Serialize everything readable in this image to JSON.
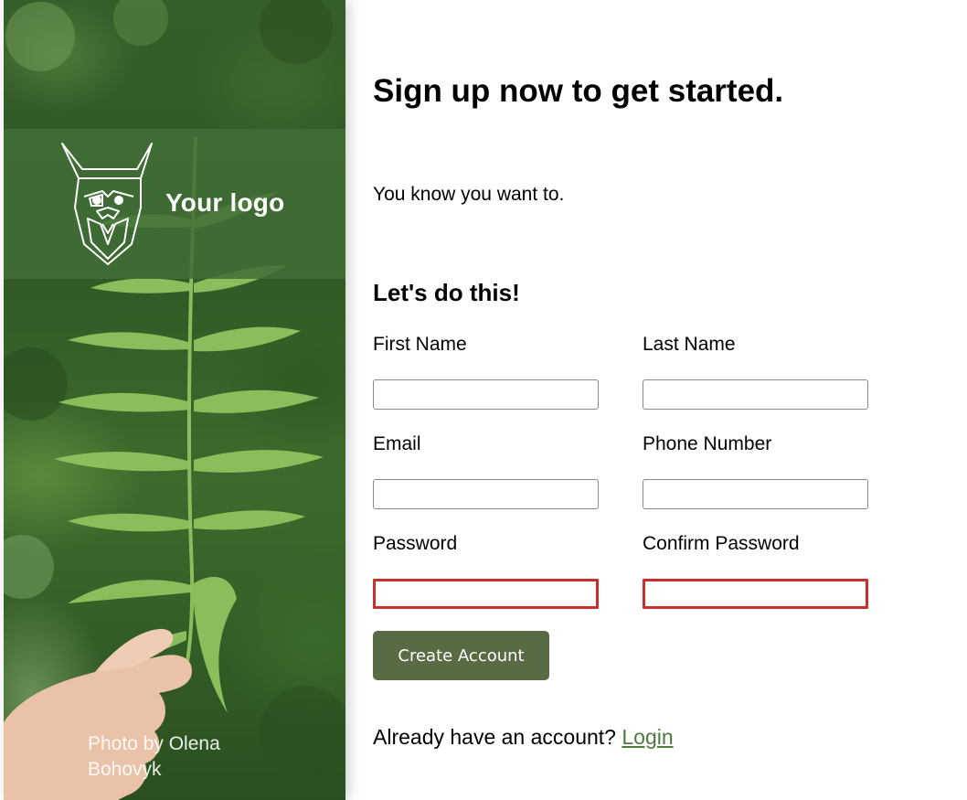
{
  "brand": {
    "logo_text": "Your logo",
    "photo_credit": "Photo by Olena Bohovyk"
  },
  "signup": {
    "headline": "Sign up now to get started.",
    "tagline": "You know you want to.",
    "subheading": "Let's do this!",
    "fields": {
      "first_name": {
        "label": "First Name",
        "value": ""
      },
      "last_name": {
        "label": "Last Name",
        "value": ""
      },
      "email": {
        "label": "Email",
        "value": ""
      },
      "phone": {
        "label": "Phone Number",
        "value": ""
      },
      "password": {
        "label": "Password",
        "value": "",
        "state": "invalid"
      },
      "confirm_password": {
        "label": "Confirm Password",
        "value": "",
        "state": "invalid"
      }
    },
    "submit_label": "Create Account",
    "login_prompt": "Already have an account?",
    "login_link": "Login"
  },
  "colors": {
    "button_bg": "#586b45",
    "link": "#4f7a3f",
    "invalid_border": "#c9302c",
    "logo_band": "#416e37"
  },
  "icons": {
    "logo": "bearded-viking-head-icon"
  }
}
